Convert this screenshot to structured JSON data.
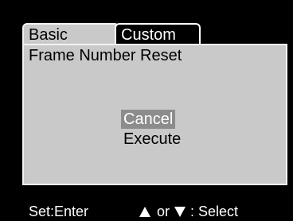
{
  "tabs": [
    {
      "label": "Basic"
    },
    {
      "label": "Custom"
    }
  ],
  "panel": {
    "title": "Frame Number Reset",
    "options": [
      "Cancel",
      "Execute"
    ],
    "selected": "Cancel"
  },
  "footer": {
    "set_hint": "Set:Enter",
    "or_text": "or",
    "select_text": ": Select",
    "up_icon": "up-triangle-icon",
    "down_icon": "down-triangle-icon"
  },
  "colors": {
    "background": "#000000",
    "panel": "#c9c9c9",
    "highlight": "#8c8c8c"
  }
}
